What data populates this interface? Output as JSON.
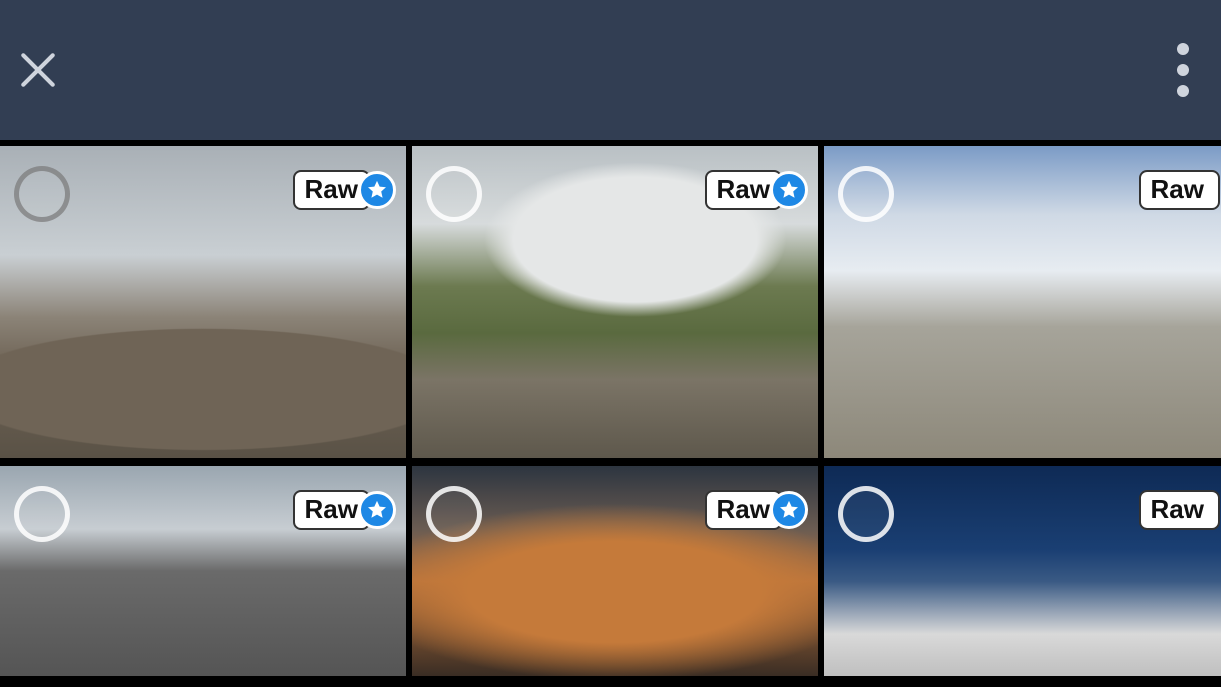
{
  "header": {
    "close_label": "Close",
    "more_label": "More options"
  },
  "badge": {
    "raw_text": "Raw",
    "star_color": "#1e88e5"
  },
  "grid": {
    "cells": [
      {
        "raw_label": "Raw",
        "starred": true,
        "selected": false
      },
      {
        "raw_label": "Raw",
        "starred": true,
        "selected": false
      },
      {
        "raw_label": "Raw",
        "starred": false,
        "selected": false
      },
      {
        "raw_label": "Raw",
        "starred": true,
        "selected": false
      },
      {
        "raw_label": "Raw",
        "starred": true,
        "selected": false
      },
      {
        "raw_label": "Raw",
        "starred": false,
        "selected": false
      }
    ]
  }
}
